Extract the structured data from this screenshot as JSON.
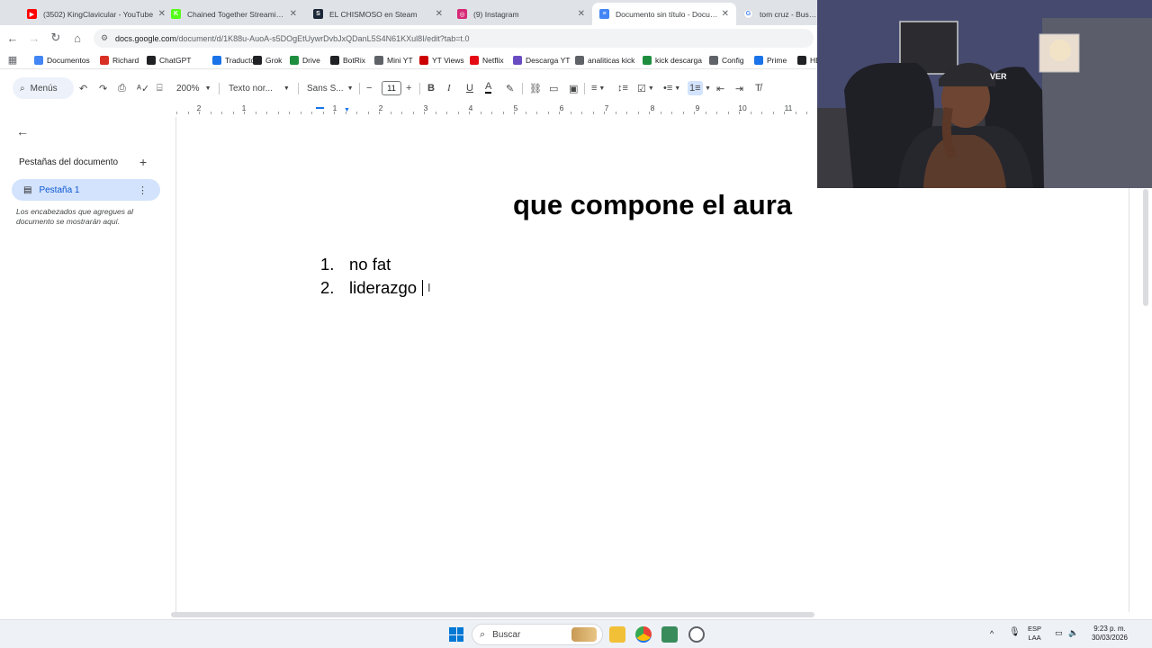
{
  "browser": {
    "tabs": [
      {
        "title": "(3502) KingClavicular - YouTube",
        "color": "#ff0000",
        "glyph": "▶",
        "active": false
      },
      {
        "title": "Chained Together Streaming - ",
        "color": "#53fc18",
        "glyph": "K",
        "active": false
      },
      {
        "title": "EL CHISMOSO en Steam",
        "color": "#1b2838",
        "glyph": "S",
        "active": false
      },
      {
        "title": "(9) Instagram",
        "color": "#d62976",
        "glyph": "◎",
        "active": false
      },
      {
        "title": "Documento sin título - Docume",
        "color": "#4285f4",
        "glyph": "≡",
        "active": true
      },
      {
        "title": "tom cruz - Buscar c",
        "color": "#ffffff",
        "glyph": "G",
        "active": false
      }
    ],
    "url_host": "docs.google.com",
    "url_path": "/document/d/1K88u-AuoA-s5DOgEtUywrDvbJxQDanL5S4N61KXul8I/edit?tab=t.0",
    "bookmarks": [
      {
        "label": "Documentos",
        "color": "#4285f4",
        "icon": "docs-icon"
      },
      {
        "label": "Richard",
        "color": "#d93025",
        "icon": "kick-icon"
      },
      {
        "label": "ChatGPT",
        "color": "#202124",
        "icon": "chatgpt-icon"
      },
      {
        "label": "Traductor",
        "color": "#1a73e8",
        "icon": "translate-icon"
      },
      {
        "label": "Grok",
        "color": "#202124",
        "icon": "grok-icon"
      },
      {
        "label": "Drive",
        "color": "#1e8e3e",
        "icon": "drive-icon"
      },
      {
        "label": "BotRix",
        "color": "#202124",
        "icon": "botrix-icon"
      },
      {
        "label": "Mini YT",
        "color": "#5f6368",
        "icon": "page-icon"
      },
      {
        "label": "YT Views",
        "color": "#cc0000",
        "icon": "yt-views-icon"
      },
      {
        "label": "Netflix",
        "color": "#e50914",
        "icon": "netflix-icon"
      },
      {
        "label": "Descarga YT",
        "color": "#6a4cc2",
        "icon": "download-icon"
      },
      {
        "label": "analiticas kick",
        "color": "#5f6368",
        "icon": "analytics-icon"
      },
      {
        "label": "kick descarga",
        "color": "#1e8e3e",
        "icon": "kick-download-icon"
      },
      {
        "label": "Config",
        "color": "#5f6368",
        "icon": "gear-icon"
      },
      {
        "label": "Prime",
        "color": "#1a73e8",
        "icon": "prime-icon"
      },
      {
        "label": "HB",
        "color": "#202124",
        "icon": "hbo-icon"
      }
    ]
  },
  "toolbar": {
    "menus_label": "Menús",
    "zoom": "200%",
    "style": "Texto nor...",
    "font": "Sans S...",
    "font_size": "11"
  },
  "ruler": {
    "labels": [
      "2",
      "1",
      "1",
      "2",
      "3",
      "4",
      "5",
      "6",
      "7",
      "8",
      "9",
      "10",
      "11"
    ]
  },
  "sidebar": {
    "section_title": "Pestañas del documento",
    "tab_label": "Pestaña 1",
    "hint": "Los encabezados que agregues al documento se mostrarán aquí."
  },
  "document": {
    "title": "que compone el aura",
    "items": [
      {
        "num": "1.",
        "text": "no fat"
      },
      {
        "num": "2.",
        "text": "liderazgo"
      }
    ]
  },
  "taskbar": {
    "search_label": "Buscar",
    "lang_1": "ESP",
    "lang_2": "LAA",
    "time": "9:23 p. m.",
    "date": "30/03/2026"
  },
  "webcam": {
    "chair_text": "VER"
  },
  "colors": {
    "accent": "#1a73e8",
    "sidebar_selected": "#d3e3fd",
    "toolbar_bg": "#edf2fa"
  }
}
